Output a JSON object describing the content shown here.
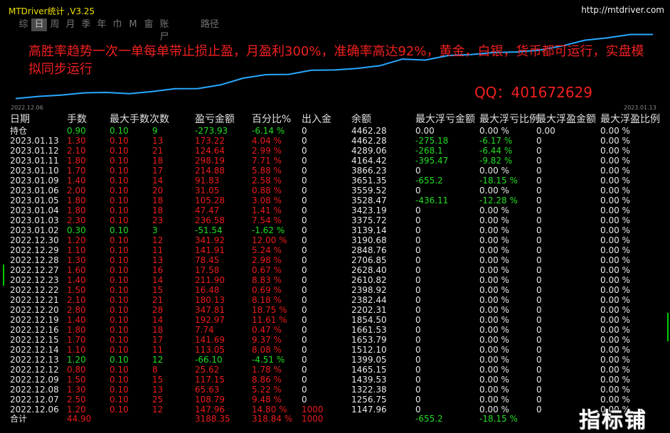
{
  "app": {
    "title": "MTDriver统计 ,V3.25",
    "url": "http://mtdriver.com"
  },
  "tabs": [
    "综",
    "日",
    "周",
    "月",
    "季",
    "年",
    "巾",
    "M",
    "畲",
    "账尸",
    "路径"
  ],
  "active_tab": 1,
  "chart": {
    "start_label": "2022.12.06",
    "end_label": "2023.01.13",
    "line_color": "#29a8ff",
    "promo": "高胜率趋势一次一单每单带止损止盈，月盈利300%，准确率高达92%，黄金，白银，货币都可运行，实盘模拟同步运行",
    "qq": "QQ：401672629",
    "equity": [
      1147.96,
      1256.75,
      1322.38,
      1439.53,
      1465.15,
      1399.05,
      1512.1,
      1653.79,
      1661.53,
      1854.5,
      2202.31,
      2382.44,
      2398.92,
      2610.82,
      2628.4,
      2706.85,
      2848.76,
      3190.68,
      3139.14,
      3375.72,
      3423.19,
      3528.47,
      3559.52,
      3651.35,
      3866.23,
      4164.42,
      4289.06,
      4462.28,
      4462.28
    ]
  },
  "headers": [
    "日期",
    "手数",
    "最大手数",
    "次数",
    "盈亏金额",
    "百分比%",
    "出入金",
    "余额",
    "最大浮亏金额",
    "最大浮亏比例",
    "最大浮盈金额",
    "最大浮盈比例"
  ],
  "rows": [
    {
      "date": "持仓",
      "lots": "0.90",
      "maxlots": "0.10",
      "count": "9",
      "pl": "-273.93",
      "pct": "-6.14 %",
      "io": "0",
      "bal": "4462.28",
      "ddamt": "0.00",
      "ddpct": "0.00 %",
      "fpamt": "0.00",
      "fppct": "0.00 %",
      "color": "green"
    },
    {
      "date": "2023.01.13",
      "lots": "1.30",
      "maxlots": "0.10",
      "count": "13",
      "pl": "173.22",
      "pct": "4.04 %",
      "io": "0",
      "bal": "4462.28",
      "ddamt": "-275.18",
      "ddpct": "-6.17 %",
      "fpamt": "0",
      "fppct": "0.00 %",
      "color": "red"
    },
    {
      "date": "2023.01.12",
      "lots": "2.10",
      "maxlots": "0.10",
      "count": "21",
      "pl": "124.64",
      "pct": "2.99 %",
      "io": "0",
      "bal": "4289.06",
      "ddamt": "-268.1",
      "ddpct": "-6.44 %",
      "fpamt": "0",
      "fppct": "0.00 %",
      "color": "red"
    },
    {
      "date": "2023.01.11",
      "lots": "1.80",
      "maxlots": "0.10",
      "count": "18",
      "pl": "298.19",
      "pct": "7.71 %",
      "io": "0",
      "bal": "4164.42",
      "ddamt": "-395.47",
      "ddpct": "-9.82 %",
      "fpamt": "0",
      "fppct": "0.00 %",
      "color": "red"
    },
    {
      "date": "2023.01.10",
      "lots": "1.70",
      "maxlots": "0.10",
      "count": "17",
      "pl": "214.88",
      "pct": "5.88 %",
      "io": "0",
      "bal": "3866.23",
      "ddamt": "0",
      "ddpct": "0.00 %",
      "fpamt": "0",
      "fppct": "0.00 %",
      "color": "red"
    },
    {
      "date": "2023.01.09",
      "lots": "1.40",
      "maxlots": "0.10",
      "count": "14",
      "pl": "91.83",
      "pct": "2.58 %",
      "io": "0",
      "bal": "3651.35",
      "ddamt": "-655.2",
      "ddpct": "-18.15 %",
      "fpamt": "0",
      "fppct": "0.00 %",
      "color": "red"
    },
    {
      "date": "2023.01.06",
      "lots": "2.00",
      "maxlots": "0.10",
      "count": "20",
      "pl": "31.05",
      "pct": "0.88 %",
      "io": "0",
      "bal": "3559.52",
      "ddamt": "0",
      "ddpct": "0.00 %",
      "fpamt": "0",
      "fppct": "0.00 %",
      "color": "red"
    },
    {
      "date": "2023.01.05",
      "lots": "1.80",
      "maxlots": "0.10",
      "count": "18",
      "pl": "105.28",
      "pct": "3.08 %",
      "io": "0",
      "bal": "3528.47",
      "ddamt": "-436.11",
      "ddpct": "-12.28 %",
      "fpamt": "0",
      "fppct": "0.00 %",
      "color": "red"
    },
    {
      "date": "2023.01.04",
      "lots": "1.80",
      "maxlots": "0.10",
      "count": "18",
      "pl": "47.47",
      "pct": "1.41 %",
      "io": "0",
      "bal": "3423.19",
      "ddamt": "0",
      "ddpct": "0.00 %",
      "fpamt": "0",
      "fppct": "0.00 %",
      "color": "red"
    },
    {
      "date": "2023.01.03",
      "lots": "2.30",
      "maxlots": "0.10",
      "count": "23",
      "pl": "236.58",
      "pct": "7.54 %",
      "io": "0",
      "bal": "3375.72",
      "ddamt": "0",
      "ddpct": "0.00 %",
      "fpamt": "0",
      "fppct": "0.00 %",
      "color": "red"
    },
    {
      "date": "2023.01.02",
      "lots": "0.30",
      "maxlots": "0.10",
      "count": "3",
      "pl": "-51.54",
      "pct": "-1.62 %",
      "io": "0",
      "bal": "3139.14",
      "ddamt": "0",
      "ddpct": "0.00 %",
      "fpamt": "0",
      "fppct": "0.00 %",
      "color": "green"
    },
    {
      "date": "2022.12.30",
      "lots": "1.20",
      "maxlots": "0.10",
      "count": "12",
      "pl": "341.92",
      "pct": "12.00 %",
      "io": "0",
      "bal": "3190.68",
      "ddamt": "0",
      "ddpct": "0.00 %",
      "fpamt": "0",
      "fppct": "0.00 %",
      "color": "red"
    },
    {
      "date": "2022.12.29",
      "lots": "1.10",
      "maxlots": "0.10",
      "count": "11",
      "pl": "141.91",
      "pct": "5.24 %",
      "io": "0",
      "bal": "2848.76",
      "ddamt": "0",
      "ddpct": "0.00 %",
      "fpamt": "0",
      "fppct": "0.00 %",
      "color": "red"
    },
    {
      "date": "2022.12.28",
      "lots": "1.30",
      "maxlots": "0.10",
      "count": "13",
      "pl": "78.45",
      "pct": "2.98 %",
      "io": "0",
      "bal": "2706.85",
      "ddamt": "0",
      "ddpct": "0.00 %",
      "fpamt": "0",
      "fppct": "0.00 %",
      "color": "red"
    },
    {
      "date": "2022.12.27",
      "lots": "1.60",
      "maxlots": "0.10",
      "count": "16",
      "pl": "17.58",
      "pct": "0.67 %",
      "io": "0",
      "bal": "2628.40",
      "ddamt": "0",
      "ddpct": "0.00 %",
      "fpamt": "0",
      "fppct": "0.00 %",
      "color": "red"
    },
    {
      "date": "2022.12.23",
      "lots": "1.40",
      "maxlots": "0.10",
      "count": "14",
      "pl": "211.90",
      "pct": "8.83 %",
      "io": "0",
      "bal": "2610.82",
      "ddamt": "0",
      "ddpct": "0.00 %",
      "fpamt": "0",
      "fppct": "0.00 %",
      "color": "red"
    },
    {
      "date": "2022.12.22",
      "lots": "1.50",
      "maxlots": "0.10",
      "count": "15",
      "pl": "16.48",
      "pct": "0.69 %",
      "io": "0",
      "bal": "2398.92",
      "ddamt": "0",
      "ddpct": "0.00 %",
      "fpamt": "0",
      "fppct": "0.00 %",
      "color": "red"
    },
    {
      "date": "2022.12.21",
      "lots": "2.10",
      "maxlots": "0.10",
      "count": "21",
      "pl": "180.13",
      "pct": "8.18 %",
      "io": "0",
      "bal": "2382.44",
      "ddamt": "0",
      "ddpct": "0.00 %",
      "fpamt": "0",
      "fppct": "0.00 %",
      "color": "red"
    },
    {
      "date": "2022.12.20",
      "lots": "2.80",
      "maxlots": "0.10",
      "count": "28",
      "pl": "347.81",
      "pct": "18.75 %",
      "io": "0",
      "bal": "2202.31",
      "ddamt": "0",
      "ddpct": "0.00 %",
      "fpamt": "0",
      "fppct": "0.00 %",
      "color": "red"
    },
    {
      "date": "2022.12.19",
      "lots": "1.40",
      "maxlots": "0.10",
      "count": "14",
      "pl": "192.97",
      "pct": "11.61 %",
      "io": "0",
      "bal": "1854.50",
      "ddamt": "0",
      "ddpct": "0.00 %",
      "fpamt": "0",
      "fppct": "0.00 %",
      "color": "red"
    },
    {
      "date": "2022.12.16",
      "lots": "1.80",
      "maxlots": "0.10",
      "count": "18",
      "pl": "7.74",
      "pct": "0.47 %",
      "io": "0",
      "bal": "1661.53",
      "ddamt": "0",
      "ddpct": "0.00 %",
      "fpamt": "0",
      "fppct": "0.00 %",
      "color": "red"
    },
    {
      "date": "2022.12.15",
      "lots": "1.70",
      "maxlots": "0.10",
      "count": "17",
      "pl": "141.69",
      "pct": "9.37 %",
      "io": "0",
      "bal": "1653.79",
      "ddamt": "0",
      "ddpct": "0.00 %",
      "fpamt": "0",
      "fppct": "0.00 %",
      "color": "red"
    },
    {
      "date": "2022.12.14",
      "lots": "1.10",
      "maxlots": "0.10",
      "count": "11",
      "pl": "113.05",
      "pct": "8.08 %",
      "io": "0",
      "bal": "1512.10",
      "ddamt": "0",
      "ddpct": "0.00 %",
      "fpamt": "0",
      "fppct": "0.00 %",
      "color": "red"
    },
    {
      "date": "2022.12.13",
      "lots": "1.20",
      "maxlots": "0.10",
      "count": "12",
      "pl": "-66.10",
      "pct": "-4.51 %",
      "io": "0",
      "bal": "1399.05",
      "ddamt": "0",
      "ddpct": "0.00 %",
      "fpamt": "0",
      "fppct": "0.00 %",
      "color": "green"
    },
    {
      "date": "2022.12.12",
      "lots": "0.80",
      "maxlots": "0.10",
      "count": "8",
      "pl": "25.62",
      "pct": "1.78 %",
      "io": "0",
      "bal": "1465.15",
      "ddamt": "0",
      "ddpct": "0.00 %",
      "fpamt": "0",
      "fppct": "0.00 %",
      "color": "red"
    },
    {
      "date": "2022.12.09",
      "lots": "1.50",
      "maxlots": "0.10",
      "count": "15",
      "pl": "117.15",
      "pct": "8.86 %",
      "io": "0",
      "bal": "1439.53",
      "ddamt": "0",
      "ddpct": "0.00 %",
      "fpamt": "0",
      "fppct": "0.00 %",
      "color": "red"
    },
    {
      "date": "2022.12.08",
      "lots": "1.30",
      "maxlots": "0.10",
      "count": "13",
      "pl": "65.63",
      "pct": "5.22 %",
      "io": "0",
      "bal": "1322.38",
      "ddamt": "0",
      "ddpct": "0.00 %",
      "fpamt": "0",
      "fppct": "0.00 %",
      "color": "red"
    },
    {
      "date": "2022.12.07",
      "lots": "2.50",
      "maxlots": "0.10",
      "count": "25",
      "pl": "108.79",
      "pct": "9.48 %",
      "io": "0",
      "bal": "1256.75",
      "ddamt": "0",
      "ddpct": "0.00 %",
      "fpamt": "0",
      "fppct": "0.00 %",
      "color": "red"
    },
    {
      "date": "2022.12.06",
      "lots": "1.20",
      "maxlots": "0.10",
      "count": "12",
      "pl": "147.96",
      "pct": "14.80 %",
      "io": "1000",
      "bal": "1147.96",
      "ddamt": "0",
      "ddpct": "0.00 %",
      "fpamt": "0",
      "fppct": "0.00 %",
      "color": "red"
    }
  ],
  "total": {
    "label": "合计",
    "lots": "44.90",
    "pl": "3188.35",
    "pct": "318.84 %",
    "io": "1000",
    "ddamt": "-655.2",
    "ddpct": "-18.15 %"
  },
  "watermark": "指标铺"
}
